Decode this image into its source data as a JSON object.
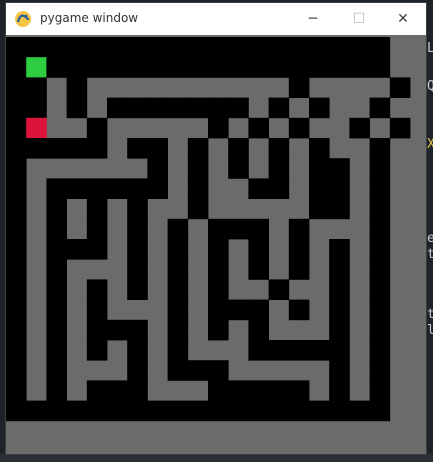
{
  "window": {
    "title": "pygame window",
    "minimize_glyph": "─",
    "maximize_glyph": "☐",
    "close_glyph": "✕"
  },
  "game": {
    "type": "maze",
    "grid_cols": 19,
    "grid_rows": 19,
    "colors": {
      "wall": "#000000",
      "path": "#6b6b6b",
      "start": "#2ecc40",
      "player": "#dc143c"
    },
    "start_cell": [
      1,
      1
    ],
    "player_cell": [
      1,
      4
    ],
    "grid": [
      "0000000000000000000",
      "0S00000000000000000",
      "00101111111111011110",
      "0010100000001010110",
      "0P110111110101011010",
      "0000010010101010110",
      "0111111010101010010",
      "0100000010110010010",
      "0101010110111110010",
      "0101010101000101110",
      "0100010101010101010",
      "0101110101010101010",
      "0101010101011011010",
      "0101011101000101010",
      "0101000101010111010",
      "0101010101110000010",
      "0101110100011111010",
      "0101000111000001010",
      "0000000000000000000"
    ]
  },
  "background_editor": {
    "fragments": [
      "L",
      "Q",
      "X",
      "e",
      "t",
      "t",
      "l"
    ],
    "bottom_text": ""
  },
  "app_icon_name": "pygame-snake-icon"
}
